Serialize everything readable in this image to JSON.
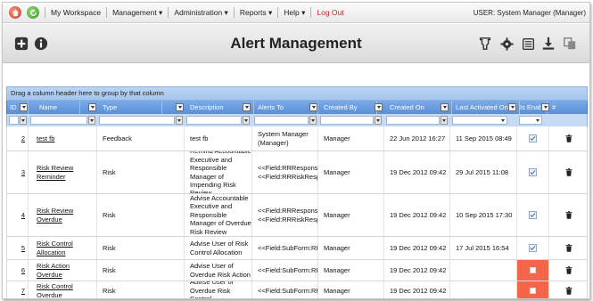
{
  "nav": {
    "items": [
      "My Workspace",
      "Management",
      "Administration",
      "Reports",
      "Help",
      "Log Out"
    ],
    "user": "USER: System Manager (Manager)"
  },
  "title": "Alert Management",
  "grid": {
    "group_hint": "Drag a column header here to group by that column",
    "columns": [
      "ID",
      "Name",
      "Type",
      "Description",
      "Alerts To",
      "Created By",
      "Created On",
      "Last Activated On",
      "Is Enabled",
      "#"
    ],
    "rows": [
      {
        "id": "2",
        "name": "test fb",
        "type": "Feedback",
        "description": "test fb",
        "alerts_to": "System Manager (Manager)",
        "created_by": "Manager",
        "created_on": "22 Jun 2012 16:27",
        "last_activated": "11 Sep 2015 08:49",
        "enabled": true
      },
      {
        "id": "3",
        "name": "Risk Review Reminder",
        "type": "Risk",
        "description": "Remind Accountable Executive and Responsible Manager of Impending Risk Review",
        "alerts_to": "<<Field:RRResponsibilityU <<Field:RRRiskResponsibl",
        "created_by": "Manager",
        "created_on": "19 Dec 2012 09:42",
        "last_activated": "29 Jul 2015 11:08",
        "enabled": true
      },
      {
        "id": "4",
        "name": "Risk Review Overdue",
        "type": "Risk",
        "description": "Advise Accountable Executive and Responsible Manager of Overdue Risk Review",
        "alerts_to": "<<Field:RRResponsibilityU <<Field:RRRiskResponsibl",
        "created_by": "Manager",
        "created_on": "19 Dec 2012 09:42",
        "last_activated": "10 Sep 2015 17:30",
        "enabled": true
      },
      {
        "id": "5",
        "name": "Risk Control Allocation",
        "type": "Risk",
        "description": "Advise User of Risk Control Allocation",
        "alerts_to": "<<Field:SubForm:RRContr",
        "created_by": "Manager",
        "created_on": "19 Dec 2012 09:42",
        "last_activated": "17 Jul 2015 16:54",
        "enabled": true
      },
      {
        "id": "6",
        "name": "Risk Action Overdue",
        "type": "Risk",
        "description": "Advise User of Overdue Risk Action",
        "alerts_to": "<<Field:SubForm:RRActior",
        "created_by": "Manager",
        "created_on": "19 Dec 2012 09:42",
        "last_activated": "",
        "enabled": false
      },
      {
        "id": "7",
        "name": "Risk Control Overdue",
        "type": "Risk",
        "description": "Advise User of Overdue Risk Control",
        "alerts_to": "<<Field:SubForm:RRContr",
        "created_by": "Manager",
        "created_on": "19 Dec 2012 09:42",
        "last_activated": "",
        "enabled": false
      }
    ]
  },
  "colors": {
    "header_blue": "#5b8fd6",
    "disabled_red": "#f4654a",
    "logout_red": "#d31f1f"
  },
  "icons": [
    "home-icon",
    "refresh-icon",
    "add-icon",
    "info-icon",
    "filter-icon",
    "gear-icon",
    "list-icon",
    "download-icon",
    "copy-icon",
    "trash-icon"
  ]
}
